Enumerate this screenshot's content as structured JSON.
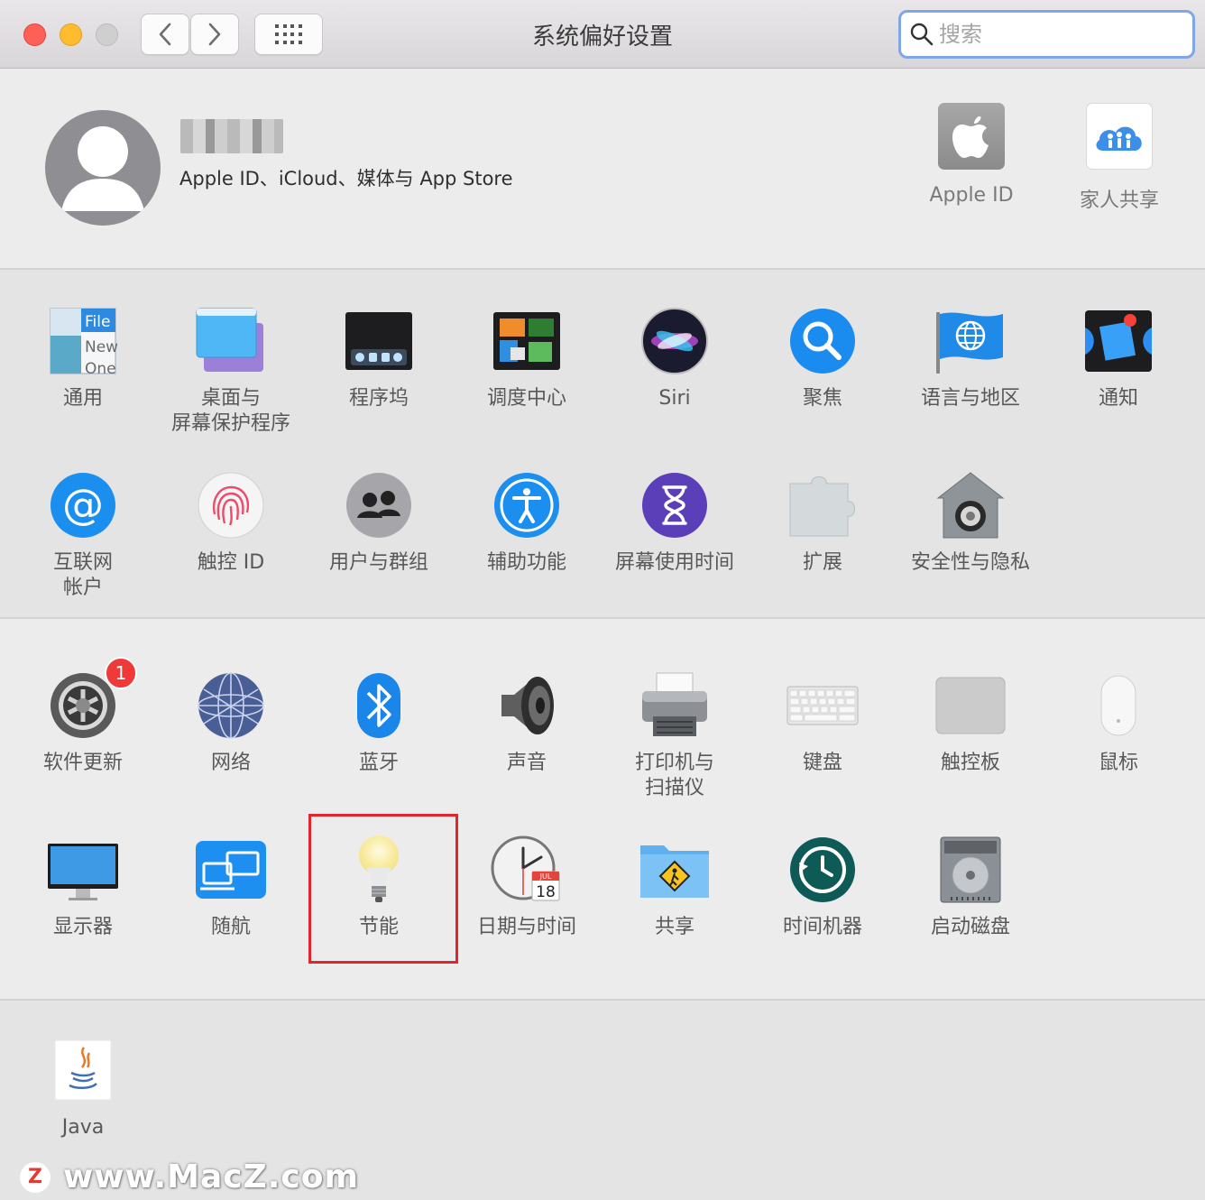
{
  "window": {
    "title": "系统偏好设置",
    "search_placeholder": "搜索"
  },
  "account": {
    "subtitle": "Apple ID、iCloud、媒体与 App Store",
    "items": [
      {
        "label": "Apple ID",
        "icon": "apple-icon"
      },
      {
        "label": "家人共享",
        "icon": "family-sharing-icon"
      }
    ]
  },
  "section1": [
    {
      "label": "通用",
      "icon": "general-icon"
    },
    {
      "label": "桌面与\n屏幕保护程序",
      "icon": "desktop-screensaver-icon"
    },
    {
      "label": "程序坞",
      "icon": "dock-icon"
    },
    {
      "label": "调度中心",
      "icon": "mission-control-icon"
    },
    {
      "label": "Siri",
      "icon": "siri-icon"
    },
    {
      "label": "聚焦",
      "icon": "spotlight-icon"
    },
    {
      "label": "语言与地区",
      "icon": "language-region-icon"
    },
    {
      "label": "通知",
      "icon": "notifications-icon"
    },
    {
      "label": "互联网\n帐户",
      "icon": "internet-accounts-icon"
    },
    {
      "label": "触控 ID",
      "icon": "touch-id-icon"
    },
    {
      "label": "用户与群组",
      "icon": "users-groups-icon"
    },
    {
      "label": "辅助功能",
      "icon": "accessibility-icon"
    },
    {
      "label": "屏幕使用时间",
      "icon": "screen-time-icon"
    },
    {
      "label": "扩展",
      "icon": "extensions-icon"
    },
    {
      "label": "安全性与隐私",
      "icon": "security-privacy-icon"
    }
  ],
  "section2": [
    {
      "label": "软件更新",
      "icon": "software-update-icon",
      "badge": "1"
    },
    {
      "label": "网络",
      "icon": "network-icon"
    },
    {
      "label": "蓝牙",
      "icon": "bluetooth-icon"
    },
    {
      "label": "声音",
      "icon": "sound-icon"
    },
    {
      "label": "打印机与\n扫描仪",
      "icon": "printers-scanners-icon"
    },
    {
      "label": "键盘",
      "icon": "keyboard-icon"
    },
    {
      "label": "触控板",
      "icon": "trackpad-icon"
    },
    {
      "label": "鼠标",
      "icon": "mouse-icon"
    },
    {
      "label": "显示器",
      "icon": "displays-icon"
    },
    {
      "label": "随航",
      "icon": "sidecar-icon"
    },
    {
      "label": "节能",
      "icon": "energy-saver-icon",
      "highlighted": true
    },
    {
      "label": "日期与时间",
      "icon": "date-time-icon",
      "calendar_month": "JUL",
      "calendar_day": "18"
    },
    {
      "label": "共享",
      "icon": "sharing-icon"
    },
    {
      "label": "时间机器",
      "icon": "time-machine-icon"
    },
    {
      "label": "启动磁盘",
      "icon": "startup-disk-icon"
    }
  ],
  "section3": [
    {
      "label": "Java",
      "icon": "java-icon"
    }
  ],
  "general_icon_text": [
    "File",
    "New",
    "One"
  ],
  "watermark": {
    "logo": "Z",
    "text": "www.MacZ.com"
  },
  "colors": {
    "highlight": "#e0262a",
    "badge": "#f03a3a",
    "search_focus": "#7fa6e8"
  }
}
